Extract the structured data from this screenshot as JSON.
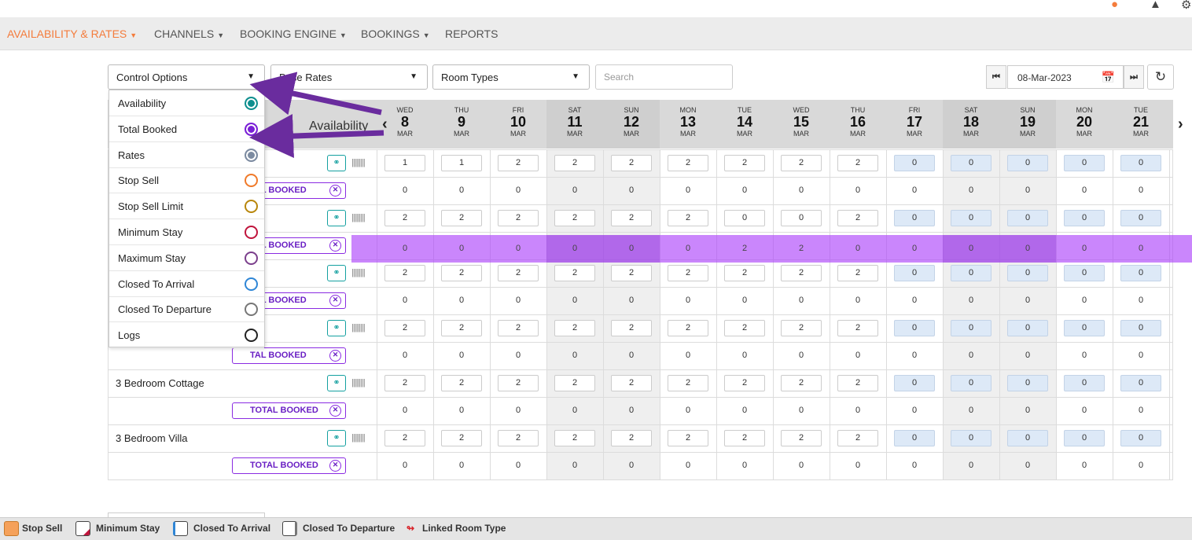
{
  "nav": {
    "items": [
      {
        "label": "AVAILABILITY & RATES",
        "active": true
      },
      {
        "label": "CHANNELS"
      },
      {
        "label": "BOOKING ENGINE"
      },
      {
        "label": "BOOKINGS"
      },
      {
        "label": "REPORTS"
      }
    ]
  },
  "toolbar": {
    "control_options": "Control Options",
    "base_rates": "Base Rates",
    "room_types": "Room Types",
    "search_placeholder": "Search",
    "date": "08-Mar-2023"
  },
  "grid": {
    "title": "Availability",
    "days": [
      {
        "dow": "WED",
        "day": "8",
        "month": "MAR"
      },
      {
        "dow": "THU",
        "day": "9",
        "month": "MAR"
      },
      {
        "dow": "FRI",
        "day": "10",
        "month": "MAR"
      },
      {
        "dow": "SAT",
        "day": "11",
        "month": "MAR"
      },
      {
        "dow": "SUN",
        "day": "12",
        "month": "MAR"
      },
      {
        "dow": "MON",
        "day": "13",
        "month": "MAR"
      },
      {
        "dow": "TUE",
        "day": "14",
        "month": "MAR"
      },
      {
        "dow": "WED",
        "day": "15",
        "month": "MAR"
      },
      {
        "dow": "THU",
        "day": "16",
        "month": "MAR"
      },
      {
        "dow": "FRI",
        "day": "17",
        "month": "MAR"
      },
      {
        "dow": "SAT",
        "day": "18",
        "month": "MAR"
      },
      {
        "dow": "SUN",
        "day": "19",
        "month": "MAR"
      },
      {
        "dow": "MON",
        "day": "20",
        "month": "MAR"
      },
      {
        "dow": "TUE",
        "day": "21",
        "month": "MAR"
      }
    ],
    "total_booked_label": "TOTAL BOOKED",
    "total_booked_short": "TAL BOOKED",
    "total_booked_mid": "TOTAL BOOKED",
    "rooms": [
      {
        "name": "",
        "avail": [
          "1",
          "1",
          "2",
          "2",
          "2",
          "2",
          "2",
          "2",
          "2",
          "0",
          "0",
          "0",
          "0",
          "0"
        ],
        "booked": [
          "0",
          "0",
          "0",
          "0",
          "0",
          "0",
          "0",
          "0",
          "0",
          "0",
          "0",
          "0",
          "0",
          "0"
        ]
      },
      {
        "name": "",
        "avail": [
          "2",
          "2",
          "2",
          "2",
          "2",
          "2",
          "0",
          "0",
          "2",
          "0",
          "0",
          "0",
          "0",
          "0"
        ],
        "booked": [
          "0",
          "0",
          "0",
          "0",
          "0",
          "0",
          "2",
          "2",
          "0",
          "0",
          "0",
          "0",
          "0",
          "0"
        ]
      },
      {
        "name": "",
        "avail": [
          "2",
          "2",
          "2",
          "2",
          "2",
          "2",
          "2",
          "2",
          "2",
          "0",
          "0",
          "0",
          "0",
          "0"
        ],
        "booked": [
          "0",
          "0",
          "0",
          "0",
          "0",
          "0",
          "0",
          "0",
          "0",
          "0",
          "0",
          "0",
          "0",
          "0"
        ]
      },
      {
        "name": "",
        "avail": [
          "2",
          "2",
          "2",
          "2",
          "2",
          "2",
          "2",
          "2",
          "2",
          "0",
          "0",
          "0",
          "0",
          "0"
        ],
        "booked": [
          "0",
          "0",
          "0",
          "0",
          "0",
          "0",
          "0",
          "0",
          "0",
          "0",
          "0",
          "0",
          "0",
          "0"
        ]
      },
      {
        "name": "3 Bedroom Cottage",
        "avail": [
          "2",
          "2",
          "2",
          "2",
          "2",
          "2",
          "2",
          "2",
          "2",
          "0",
          "0",
          "0",
          "0",
          "0"
        ],
        "booked": [
          "0",
          "0",
          "0",
          "0",
          "0",
          "0",
          "0",
          "0",
          "0",
          "0",
          "0",
          "0",
          "0",
          "0"
        ]
      },
      {
        "name": "3 Bedroom Villa",
        "avail": [
          "2",
          "2",
          "2",
          "2",
          "2",
          "2",
          "2",
          "2",
          "2",
          "0",
          "0",
          "0",
          "0",
          "0"
        ],
        "booked": [
          "0",
          "0",
          "0",
          "0",
          "0",
          "0",
          "0",
          "0",
          "0",
          "0",
          "0",
          "0",
          "0",
          "0"
        ]
      }
    ]
  },
  "menu": {
    "items": [
      {
        "label": "Availability",
        "color": "#0f8f8f",
        "filled": true
      },
      {
        "label": "Total Booked",
        "color": "#7a1fd6",
        "filled": true
      },
      {
        "label": "Rates",
        "color": "#7c8ba1",
        "filled": true
      },
      {
        "label": "Stop Sell",
        "color": "#f07a2a",
        "filled": false
      },
      {
        "label": "Stop Sell Limit",
        "color": "#b8860b",
        "filled": false
      },
      {
        "label": "Minimum Stay",
        "color": "#c0143c",
        "filled": false
      },
      {
        "label": "Maximum Stay",
        "color": "#7b3f8c",
        "filled": false
      },
      {
        "label": "Closed To Arrival",
        "color": "#2f86d6",
        "filled": false
      },
      {
        "label": "Closed To Departure",
        "color": "#777777",
        "filled": false
      },
      {
        "label": "Logs",
        "color": "#222222",
        "filled": false
      }
    ]
  },
  "legend": {
    "stop_sell": "Stop Sell",
    "minimum_stay": "Minimum Stay",
    "closed_to_arrival": "Closed To Arrival",
    "closed_to_departure": "Closed To Departure",
    "linked_room_type": "Linked Room Type"
  },
  "colors": {
    "accent": "#f47c3c",
    "highlight": "#b04cf7",
    "arrow": "#6a2c9e"
  }
}
